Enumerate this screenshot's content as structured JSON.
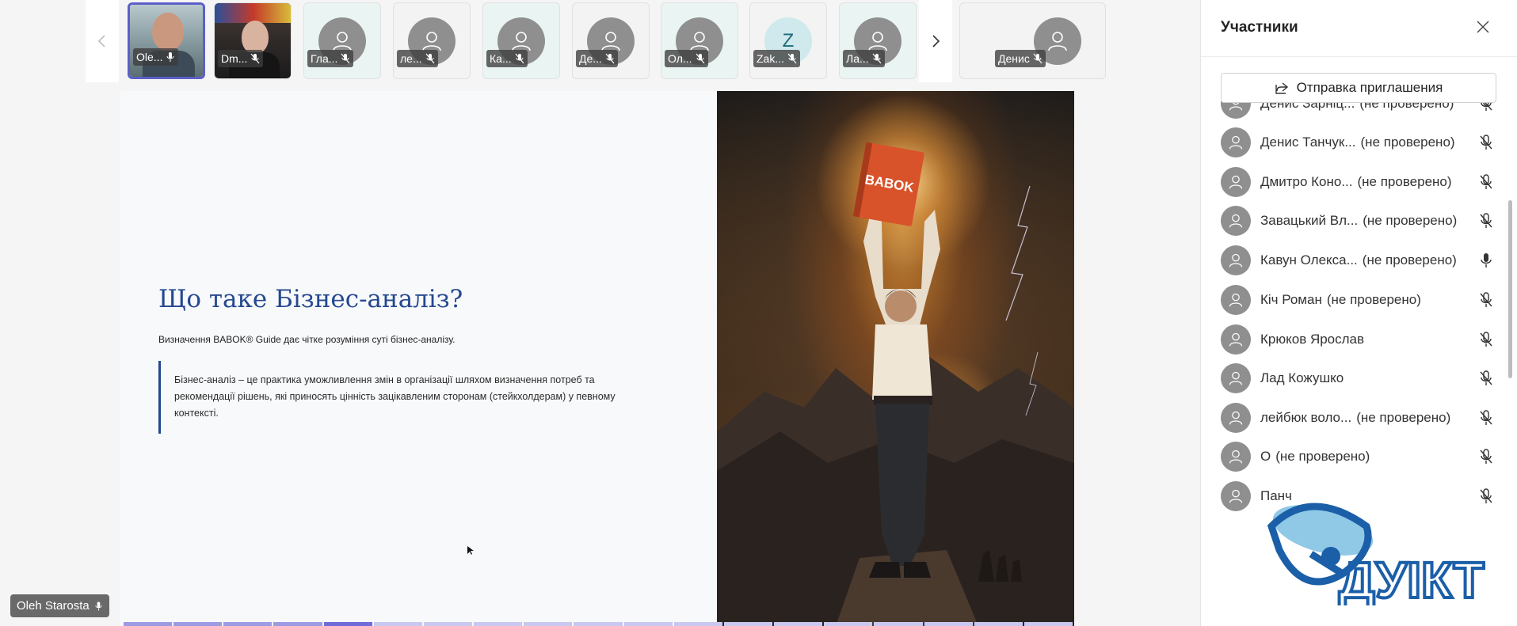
{
  "strip": {
    "prev_label": "",
    "next_label": "",
    "tiles": [
      {
        "name": "Ole...",
        "type": "photo1"
      },
      {
        "name": "Dm...",
        "type": "photo2"
      },
      {
        "name": "Гла...",
        "type": "avatar"
      },
      {
        "name": "ле...",
        "type": "avatar"
      },
      {
        "name": "Ка...",
        "type": "avatar"
      },
      {
        "name": "Де...",
        "type": "avatar"
      },
      {
        "name": "Ол...",
        "type": "avatar"
      },
      {
        "name": "Zak...",
        "type": "letter",
        "letter": "Z"
      },
      {
        "name": "Ла...",
        "type": "avatar"
      }
    ],
    "overflow_tile": {
      "name": "Денис"
    }
  },
  "slide": {
    "title": "Що таке Бізнес-аналіз?",
    "subtitle": "Визначення BABOK® Guide дає чітке розуміння суті бізнес-аналізу.",
    "quote_line1": "Бізнес-аналіз – це практика уможливлення змін в організації шляхом визначення потреб та",
    "quote_line2": "рекомендації рішень, які приносять цінність зацікавленим сторонам (стейкхолдерам) у певному",
    "quote_line3": "контексті.",
    "book_title": "BABOK",
    "progress_total": 19,
    "progress_current": 5
  },
  "self_view": {
    "name": "Oleh Starosta"
  },
  "panel": {
    "title": "Участники",
    "invite_label": "Отправка приглашения",
    "participants": [
      {
        "name": "Денис Зарніц...",
        "status": "(не проверено)",
        "muted": true
      },
      {
        "name": "Денис Танчук...",
        "status": "(не проверено)",
        "muted": true
      },
      {
        "name": "Дмитро Коно...",
        "status": "(не проверено)",
        "muted": true
      },
      {
        "name": "Завацький Вл...",
        "status": "(не проверено)",
        "muted": true
      },
      {
        "name": "Кавун Олекса...",
        "status": "(не проверено)",
        "muted": false
      },
      {
        "name": "Кіч Роман",
        "status": "(не проверено)",
        "muted": true
      },
      {
        "name": "Крюков Ярослав",
        "status": "",
        "muted": true
      },
      {
        "name": "Лад Кожушко",
        "status": "",
        "muted": true
      },
      {
        "name": "лейбюк воло...",
        "status": "(не проверено)",
        "muted": true
      },
      {
        "name": "О",
        "status": "(не проверено)",
        "muted": true
      },
      {
        "name": "Панч",
        "status": "",
        "muted": true
      }
    ]
  },
  "watermark": {
    "text": "ДУІКТ"
  },
  "colors": {
    "accent": "#5b5fc7",
    "title_blue": "#25488f"
  }
}
